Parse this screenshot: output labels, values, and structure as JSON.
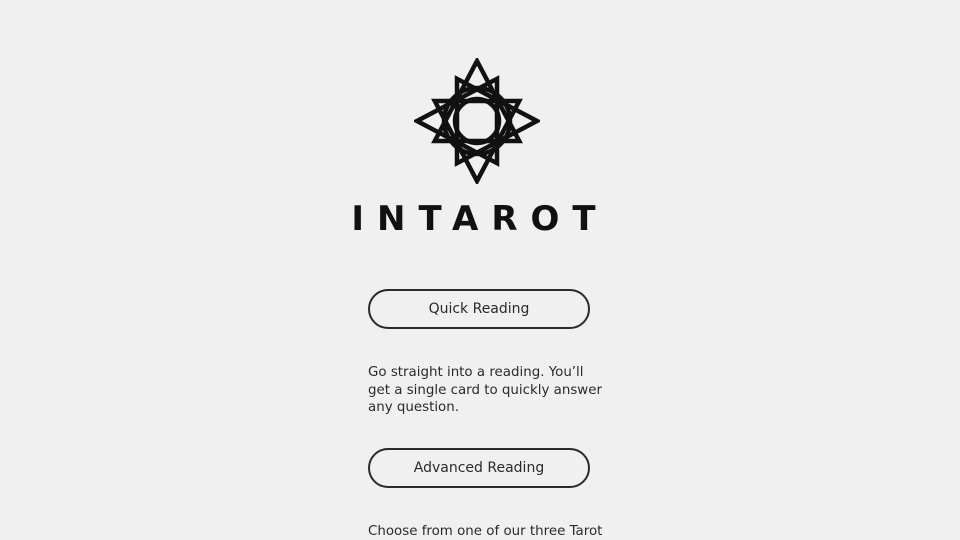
{
  "brand": {
    "name": "INTAROT",
    "logo_icon": "eight-point-star-circle-icon"
  },
  "options": [
    {
      "label": "Quick Reading",
      "description": "Go straight into a reading. You’ll get a single card to quickly answer any question."
    },
    {
      "label": "Advanced Reading",
      "description": "Choose from one of our three Tarot"
    }
  ],
  "colors": {
    "background": "#f0f0f0",
    "foreground": "#2a2a2a",
    "logo": "#111111"
  }
}
